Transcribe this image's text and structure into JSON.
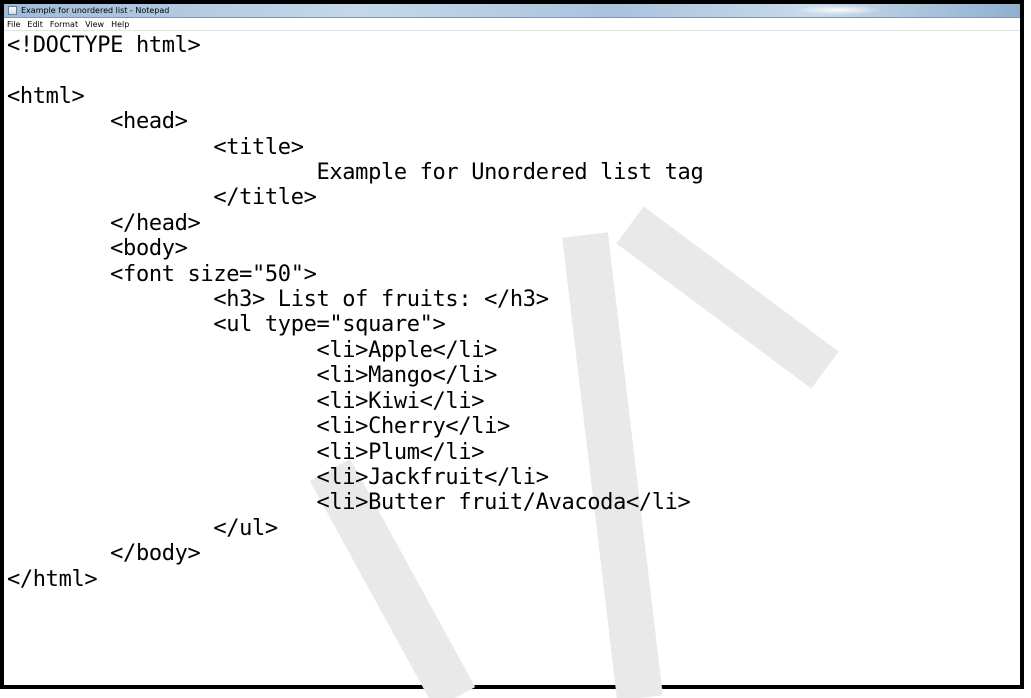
{
  "window": {
    "title": "Example for unordered list - Notepad"
  },
  "menu": [
    "File",
    "Edit",
    "Format",
    "View",
    "Help"
  ],
  "editor": {
    "lines": [
      "<!DOCTYPE html>",
      "",
      "<html>",
      "        <head>",
      "                <title>",
      "                        Example for Unordered list tag",
      "                </title>",
      "        </head>",
      "        <body>",
      "        <font size=\"50\">",
      "                <h3> List of fruits: </h3>",
      "                <ul type=\"square\">",
      "                        <li>Apple</li>",
      "                        <li>Mango</li>",
      "                        <li>Kiwi</li>",
      "                        <li>Cherry</li>",
      "                        <li>Plum</li>",
      "                        <li>Jackfruit</li>",
      "                        <li>Butter fruit/Avacoda</li>",
      "                </ul>",
      "        </body>",
      "</html>"
    ]
  },
  "colors": {
    "watermark": "#e9e9e9",
    "titlebar": "#b3cbe3",
    "border": "#000000"
  },
  "icons": {
    "app": "notepad-icon"
  }
}
